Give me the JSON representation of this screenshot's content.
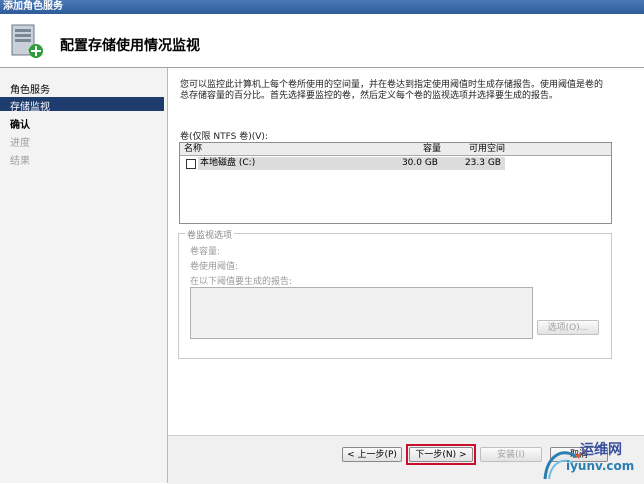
{
  "window": {
    "title": "添加角色服务"
  },
  "header": {
    "title": "配置存储使用情况监视"
  },
  "nav": {
    "items": [
      {
        "label": "角色服务",
        "state": "normal"
      },
      {
        "label": "存储监视",
        "state": "active"
      },
      {
        "label": "确认",
        "state": "bold"
      },
      {
        "label": "进度",
        "state": "disabled"
      },
      {
        "label": "结果",
        "state": "disabled"
      }
    ]
  },
  "main": {
    "description": "您可以监控此计算机上每个卷所使用的空间量，并在卷达到指定使用阈值时生成存储报告。使用阈值是卷的总存储容量的百分比。首先选择要监控的卷，然后定义每个卷的监视选项并选择要生成的报告。",
    "volumes_label": "卷(仅限 NTFS 卷)(V):",
    "table": {
      "headers": [
        "名称",
        "容量",
        "可用空间"
      ],
      "rows": [
        {
          "name": "本地磁盘 (C:)",
          "capacity": "30.0 GB",
          "free": "23.3 GB",
          "checked": false
        }
      ]
    },
    "options": {
      "legend": "卷监视选项",
      "capacity_label": "卷容量:",
      "threshold_label": "卷使用阈值:",
      "reports_label": "在以下阈值要生成的报告:",
      "options_button": "选项(O)..."
    }
  },
  "footer": {
    "prev": "< 上一步(P)",
    "next": "下一步(N) >",
    "install": "安装(I)",
    "cancel": "取消"
  },
  "watermark": {
    "text1": "运维网",
    "text2": "iyunv.com"
  },
  "colors": {
    "accent": "#1f3c6e",
    "highlight": "#c8102e"
  }
}
